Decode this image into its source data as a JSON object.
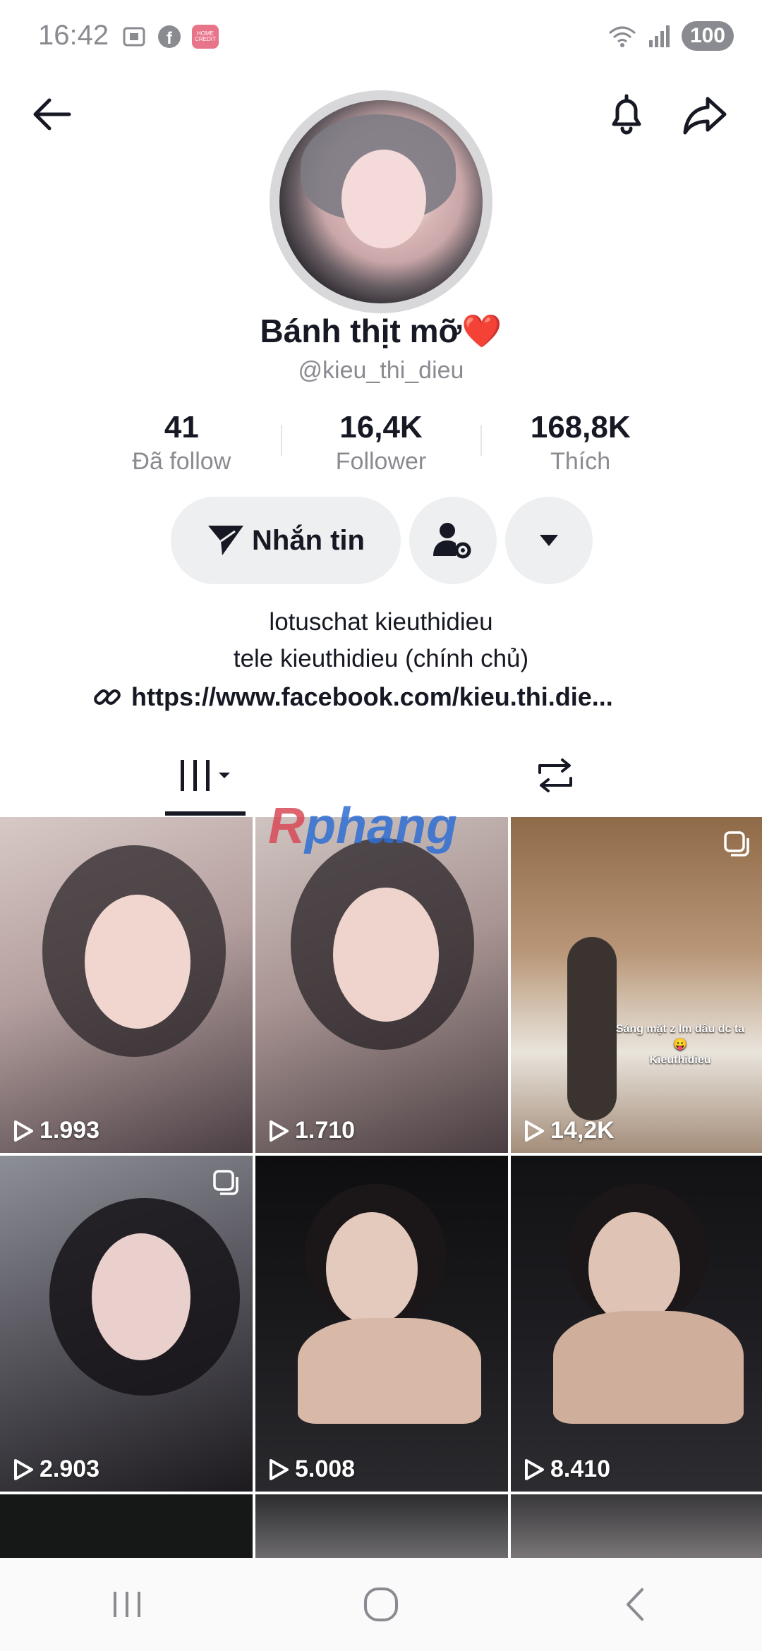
{
  "status_bar": {
    "time": "16:42",
    "battery": "100",
    "home_credit": "HOME CREDIT"
  },
  "profile": {
    "display_name": "Bánh thịt mỡ❤️",
    "username": "@kieu_thi_dieu",
    "stats": [
      {
        "value": "41",
        "label": "Đã follow"
      },
      {
        "value": "16,4K",
        "label": "Follower"
      },
      {
        "value": "168,8K",
        "label": "Thích"
      }
    ],
    "message_label": "Nhắn tin",
    "bio_line1": "lotuschat kieuthidieu",
    "bio_line2": "tele kieuthidieu (chính chủ)",
    "link": "https://www.facebook.com/kieu.thi.die..."
  },
  "watermark": "Rphang",
  "videos": [
    {
      "views": "1.993",
      "multi": false
    },
    {
      "views": "1.710",
      "multi": false
    },
    {
      "views": "14,2K",
      "multi": true,
      "caption_line1": "Sáng mặt z lm dâu dc ta😛",
      "caption_line2": "Kieuthidieu"
    },
    {
      "views": "2.903",
      "multi": true
    },
    {
      "views": "5.008",
      "multi": false
    },
    {
      "views": "8.410",
      "multi": false
    }
  ],
  "colors": {
    "text": "#161823",
    "secondary": "#8a8b91",
    "button_bg": "#eeeff1"
  }
}
